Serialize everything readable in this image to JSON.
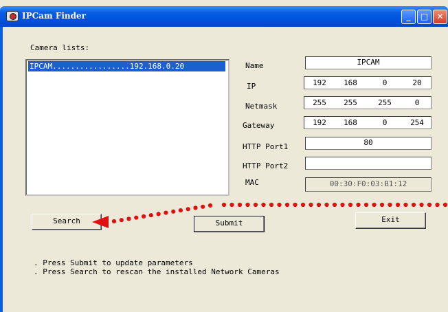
{
  "window": {
    "title": "IPCam Finder",
    "minimize_glyph": "_",
    "maximize_glyph": "□",
    "close_glyph": "✕"
  },
  "camera_list": {
    "label": "Camera lists:",
    "items": [
      {
        "text": "IPCAM.................192.168.0.20",
        "selected": true
      }
    ]
  },
  "fields": {
    "name": {
      "label": "Name",
      "value": "IPCAM"
    },
    "ip": {
      "label": "IP",
      "octets": [
        "192",
        "168",
        "0",
        "20"
      ]
    },
    "netmask": {
      "label": "Netmask",
      "octets": [
        "255",
        "255",
        "255",
        "0"
      ]
    },
    "gateway": {
      "label": "Gateway",
      "octets": [
        "192",
        "168",
        "0",
        "254"
      ]
    },
    "http_port1": {
      "label": "HTTP Port1",
      "value": "80"
    },
    "http_port2": {
      "label": "HTTP Port2",
      "value": ""
    },
    "mac": {
      "label": "MAC",
      "value": "00:30:F0:03:B1:12"
    }
  },
  "buttons": {
    "search": "Search",
    "submit": "Submit",
    "exit": "Exit"
  },
  "notes": [
    ". Press Submit to update parameters",
    ". Press Search to rescan the installed Network Cameras"
  ],
  "annotation": {
    "color": "#e01010",
    "icon": "dotted-arrow-left"
  }
}
